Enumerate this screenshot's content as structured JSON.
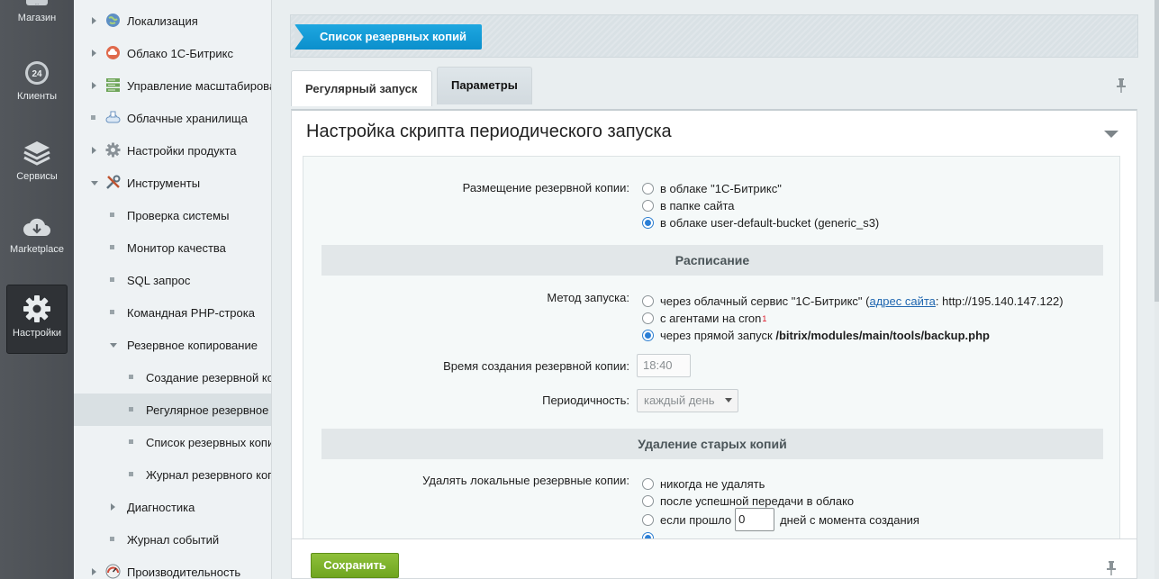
{
  "rail": [
    {
      "label": "Магазин",
      "icon": "shop-icon"
    },
    {
      "label": "Клиенты",
      "icon": "clients-24-icon"
    },
    {
      "label": "Сервисы",
      "icon": "layers-icon"
    },
    {
      "label": "Marketplace",
      "icon": "cloud-download-icon"
    },
    {
      "label": "Настройки",
      "icon": "gear-icon",
      "active": true
    }
  ],
  "menu": [
    {
      "label": "Локализация",
      "icon": "globe-icon"
    },
    {
      "label": "Облако 1С-Битрикс",
      "icon": "cloud-icon"
    },
    {
      "label": "Управление масштабирова",
      "icon": "servers-icon"
    },
    {
      "label": "Облачные хранилища",
      "icon": "cloud-storage-icon"
    },
    {
      "label": "Настройки продукта",
      "icon": "gear-icon"
    },
    {
      "label": "Инструменты",
      "icon": "tools-icon"
    },
    {
      "label": "Проверка системы"
    },
    {
      "label": "Монитор качества"
    },
    {
      "label": "SQL запрос"
    },
    {
      "label": "Командная PHP-строка"
    },
    {
      "label": "Резервное копирование"
    },
    {
      "label": "Создание резервной ко"
    },
    {
      "label": "Регулярное резервное"
    },
    {
      "label": "Список резервных копи"
    },
    {
      "label": "Журнал резервного коп"
    },
    {
      "label": "Диагностика"
    },
    {
      "label": "Журнал событий"
    },
    {
      "label": "Производительность",
      "icon": "speedometer-icon"
    }
  ],
  "topbar": {
    "back_button": "Список резервных копий"
  },
  "tabs": [
    {
      "label": "Регулярный запуск"
    },
    {
      "label": "Параметры",
      "active": true
    }
  ],
  "panel": {
    "title": "Настройка скрипта периодического запуска",
    "placement": {
      "label": "Размещение резервной копии:",
      "options": [
        "в облаке \"1С-Битрикс\"",
        "в папке сайта",
        "в облаке user-default-bucket (generic_s3)"
      ],
      "selected": 2
    },
    "schedule_header": "Расписание",
    "method": {
      "label": "Метод запуска:",
      "opt1_prefix": "через облачный сервис \"1С-Битрикс\" (",
      "opt1_link": "адрес сайта",
      "opt1_suffix": ": http://195.140.147.122)",
      "opt2_text": "с агентами на cron",
      "opt2_sup": "1",
      "opt3_prefix": "через прямой запуск ",
      "opt3_bold": "/bitrix/modules/main/tools/backup.php",
      "selected": 2
    },
    "time": {
      "label": "Время создания резервной копии:",
      "value": "18:40"
    },
    "period": {
      "label": "Периодичность:",
      "value": "каждый день"
    },
    "delete_header": "Удаление старых копий",
    "delete": {
      "label": "Удалять локальные резервные копии:",
      "opt1": "никогда не удалять",
      "opt2": "после успешной передачи в облако",
      "opt3_prefix": "если прошло",
      "opt3_value": "0",
      "opt3_suffix": "дней с момента создания"
    }
  },
  "footer": {
    "save_button": "Сохранить"
  }
}
